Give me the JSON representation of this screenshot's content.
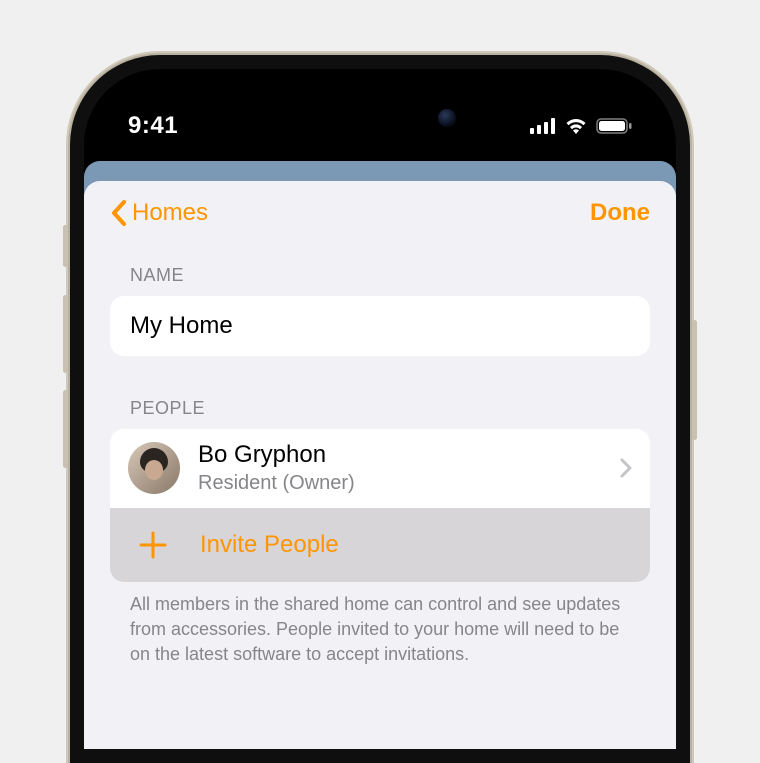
{
  "status": {
    "time": "9:41"
  },
  "nav": {
    "back_label": "Homes",
    "done_label": "Done"
  },
  "sections": {
    "name_header": "NAME",
    "name_value": "My Home",
    "people_header": "PEOPLE"
  },
  "people": [
    {
      "name": "Bo Gryphon",
      "role": "Resident (Owner)"
    }
  ],
  "invite": {
    "label": "Invite People"
  },
  "footer": {
    "text": "All members in the shared home can control and see updates from accessories. People invited to your home will need to be on the latest software to accept invitations."
  },
  "colors": {
    "accent": "#ff9500",
    "sheet_bg": "#f2f2f6",
    "cell_bg": "#ffffff",
    "secondary_text": "#86868a",
    "invite_bg": "#d7d5d8"
  }
}
